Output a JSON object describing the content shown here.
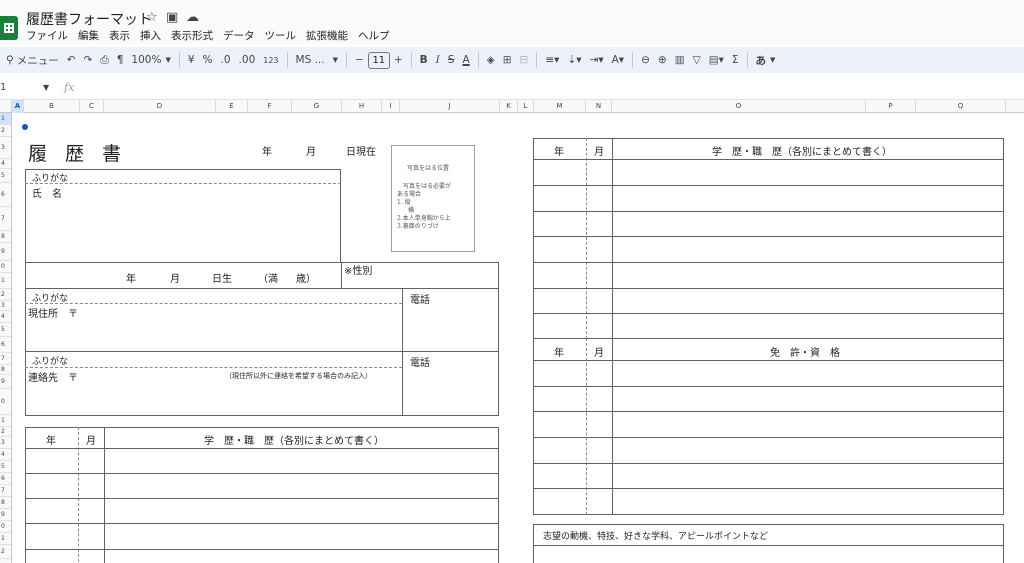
{
  "app": {
    "doc_title": "履歴書フォーマット",
    "menu": [
      "ファイル",
      "編集",
      "表示",
      "挿入",
      "表示形式",
      "データ",
      "ツール",
      "拡張機能",
      "ヘルプ"
    ]
  },
  "toolbar": {
    "search_label": "メニュー",
    "zoom": "100%",
    "currency": "¥",
    "percent": "%",
    "decrease_decimal": ".0",
    "increase_decimal": ".00",
    "number_format": "123",
    "font_name": "MS ...",
    "font_size": "11",
    "ime_label": "あ"
  },
  "formula_bar": {
    "cell_ref": "1",
    "fx_label": "fx"
  },
  "grid": {
    "columns": [
      "A",
      "B",
      "C",
      "D",
      "E",
      "F",
      "G",
      "H",
      "I",
      "J",
      "K",
      "L",
      "M",
      "N",
      "O",
      "P",
      "Q"
    ],
    "rows": [
      "1",
      "2",
      "3",
      "4",
      "5",
      "6",
      "7",
      "8",
      "9",
      "0",
      "1",
      "2",
      "3",
      "4",
      "5",
      "6",
      "7",
      "8",
      "9",
      "0",
      "1",
      "2",
      "3",
      "4",
      "5",
      "6",
      "7",
      "8",
      "9",
      "0",
      "1",
      "2"
    ]
  },
  "resume": {
    "title": "履 歴 書",
    "year": "年",
    "month": "月",
    "as_of": "日現在",
    "photo": {
      "title": "写真をはる位置",
      "line1": "写真をはる必要が",
      "line2": "ある場合",
      "line3": "1. 縦",
      "line4": "横",
      "line5": "2.本人単身胸から上",
      "line6": "3.裏面のりづけ"
    },
    "furigana": "ふりがな",
    "name": "氏　名",
    "birth_year": "年",
    "birth_month": "月",
    "birth_day": "日生",
    "age_open": "（満",
    "age_close": "歳）",
    "gender": "※性別",
    "address": "現住所　〒",
    "phone": "電話",
    "contact": "連絡先　〒",
    "contact_note": "（現住所以外に連絡を希望する場合のみ記入）",
    "history_header": "学　歴・職　歴（各別にまとめて書く）",
    "license_header": "免　許・資　格",
    "motivation": "志望の動機、特技、好きな学科、アピールポイントなど"
  }
}
